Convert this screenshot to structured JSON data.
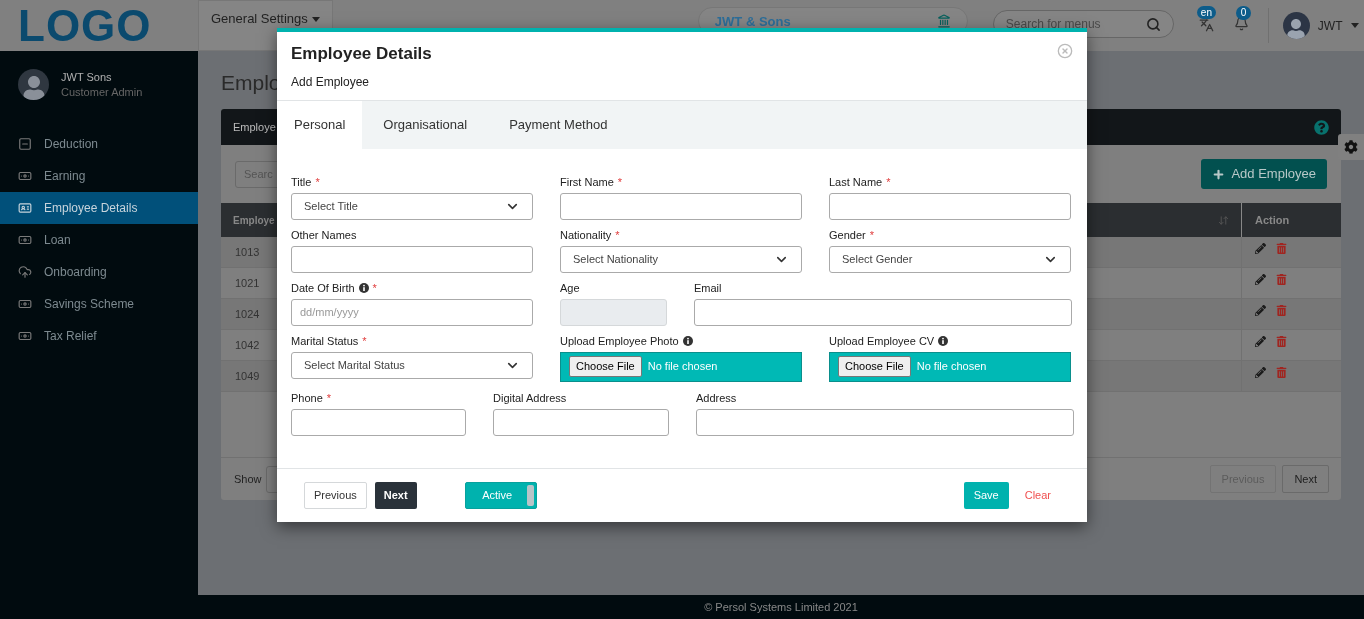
{
  "header": {
    "logo": "LOGO",
    "menu": "General Settings",
    "company": "JWT & Sons",
    "search_placeholder": "Search for menus",
    "language": "en",
    "notifications": "0",
    "user": "JWT"
  },
  "sidebar": {
    "user": {
      "name": "JWT Sons",
      "role": "Customer Admin"
    },
    "items": [
      {
        "label": "Deduction",
        "selected": false
      },
      {
        "label": "Earning",
        "selected": false
      },
      {
        "label": "Employee Details",
        "selected": true
      },
      {
        "label": "Loan",
        "selected": false
      },
      {
        "label": "Onboarding",
        "selected": false
      },
      {
        "label": "Savings Scheme",
        "selected": false
      },
      {
        "label": "Tax Relief",
        "selected": false
      }
    ]
  },
  "page": {
    "title": "Emplo",
    "card_title": "Employe",
    "search_placeholder": "Searc",
    "add_button": "Add Employee",
    "columns": [
      "Employe",
      "Action"
    ],
    "rows": [
      {
        "id": "1013"
      },
      {
        "id": "1021"
      },
      {
        "id": "1024"
      },
      {
        "id": "1042"
      },
      {
        "id": "1049"
      }
    ],
    "show_label": "Show",
    "pagination": [
      {
        "label": "Previous",
        "disabled": true
      },
      {
        "label": "Next",
        "disabled": false
      }
    ]
  },
  "footer": "© Persol Systems Limited 2021",
  "modal": {
    "title": "Employee Details",
    "subtitle": "Add Employee",
    "tabs": [
      {
        "label": "Personal",
        "selected": true
      },
      {
        "label": "Organisational",
        "selected": false
      },
      {
        "label": "Payment Method",
        "selected": false
      }
    ],
    "form_rows": [
      [
        {
          "label": "Title",
          "required_mark": "*",
          "info": false,
          "kind": "select",
          "placeholder": "Select Title"
        },
        {
          "label": "First Name",
          "required_mark": "*",
          "info": false,
          "kind": "input"
        },
        {
          "label": "Last Name",
          "required_mark": "*",
          "info": false,
          "kind": "input"
        }
      ],
      [
        {
          "label": "Other Names",
          "info": false,
          "kind": "input"
        },
        {
          "label": "Nationality",
          "required_mark": "*",
          "info": false,
          "kind": "select",
          "placeholder": "Select Nationality"
        },
        {
          "label": "Gender",
          "required_mark": "*",
          "info": false,
          "kind": "select",
          "placeholder": "Select Gender"
        }
      ],
      [
        {
          "label": "Date Of Birth",
          "required_mark": "*",
          "info": true,
          "kind": "input",
          "placeholder": "dd/mm/yyyy"
        },
        {
          "label": "Age",
          "info": false,
          "kind": "readonly"
        },
        {
          "label": "Email",
          "info": false,
          "kind": "input"
        }
      ],
      [
        {
          "label": "Marital Status",
          "required_mark": "*",
          "info": false,
          "kind": "select",
          "placeholder": "Select Marital Status"
        },
        {
          "label": "Upload Employee Photo",
          "info": true,
          "kind": "file",
          "button": "Choose File",
          "status": "No file chosen"
        },
        {
          "label": "Upload Employee CV",
          "info": true,
          "kind": "file",
          "button": "Choose File",
          "status": "No file chosen"
        }
      ],
      [
        {
          "label": "Phone",
          "required_mark": "*",
          "info": false,
          "kind": "input"
        },
        {
          "label": "Digital Address",
          "info": false,
          "kind": "input"
        },
        {
          "label": "Address",
          "info": false,
          "kind": "input"
        }
      ]
    ],
    "previous": "Previous",
    "next": "Next",
    "status": {
      "label": "Active",
      "on": true
    },
    "save": "Save",
    "clear": "Clear"
  }
}
